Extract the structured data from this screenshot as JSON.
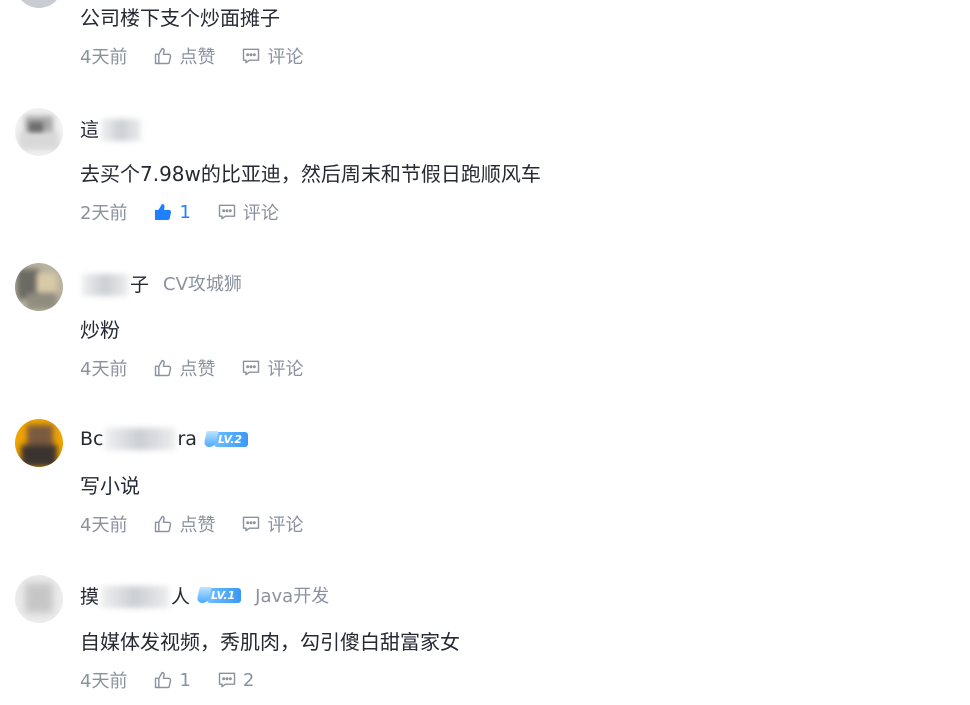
{
  "comments": [
    {
      "name": "",
      "title": "",
      "level": "",
      "content": "公司楼下支个炒面摊子",
      "time": "4天前",
      "like_label": "点赞",
      "comment_label": "评论",
      "liked": false
    },
    {
      "name_prefix": "這",
      "content": "去买个7.98w的比亚迪，然后周末和节假日跑顺风车",
      "time": "2天前",
      "like_label": "1",
      "comment_label": "评论",
      "liked": true
    },
    {
      "name_suffix": "子",
      "title": "CV攻城狮",
      "content": "炒粉",
      "time": "4天前",
      "like_label": "点赞",
      "comment_label": "评论",
      "liked": false
    },
    {
      "name_prefix": "Bc",
      "name_suffix": "ra",
      "level": "LV.2",
      "content": "写小说",
      "time": "4天前",
      "like_label": "点赞",
      "comment_label": "评论",
      "liked": false
    },
    {
      "name_prefix": "摸",
      "name_suffix": "人",
      "level": "LV.1",
      "title": "Java开发",
      "content": "自媒体发视频，秀肌肉，勾引傻白甜富家女",
      "time": "4天前",
      "like_label": "1",
      "comment_label": "2",
      "liked": false
    }
  ],
  "colors": {
    "accent": "#1e80ff",
    "muted": "#8a919f",
    "text": "#252933",
    "badge": "#3a98f5"
  },
  "icons": {
    "like": "thumbs-up-icon",
    "comment": "comment-bubble-icon",
    "level": "flask-icon"
  }
}
